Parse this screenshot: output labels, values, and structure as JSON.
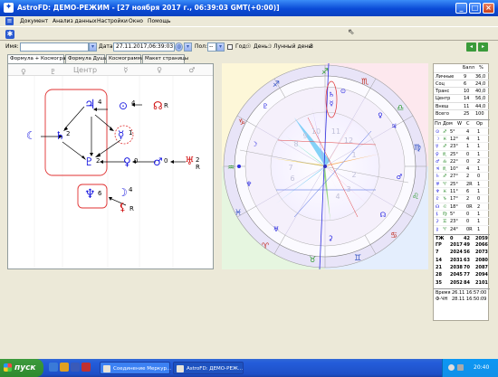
{
  "window": {
    "title": "AstroFD: ДЕМО-РЕЖИМ - [27 ноября 2017 г., 06:39:03 GMT(+0:00)]",
    "minimize": "_",
    "maximize": "□",
    "close": "×"
  },
  "menu": [
    "Документ",
    "Анализ данных",
    "Настройки",
    "Окно",
    "Помощь"
  ],
  "toolbar": {
    "name_label": "Имя:",
    "name_value": "",
    "date_label": "Дата:",
    "date_value": "27.11.2017,06:39:03",
    "pol_label": "Пол:",
    "pol_value": "--",
    "year_label": "Год:",
    "day_label": "День:",
    "lunar_label": "Лунный день:",
    "lunar_value": "8"
  },
  "tabs": [
    "Формула + Космограмма",
    "Формула Души",
    "Космограмма",
    "Макет страницы"
  ],
  "formula": {
    "col_header": "Центр",
    "col_symbols": [
      "☿",
      "♀",
      "♂"
    ],
    "glyphs": [
      {
        "sym": "☾",
        "color": "#1a1ae0"
      },
      {
        "sym": "♄",
        "color": "#1a1ae0",
        "n": "2"
      },
      {
        "sym": "♃",
        "color": "#1a1ae0",
        "n": "4"
      },
      {
        "sym": "⊙",
        "color": "#1a1ae0",
        "n": "4"
      },
      {
        "sym": "☊",
        "color": "#d01010",
        "n": "R"
      },
      {
        "sym": "☿",
        "color": "#1a1ae0",
        "n": "1"
      },
      {
        "sym": "♇",
        "color": "#1a1ae0",
        "n": "2"
      },
      {
        "sym": "♀",
        "color": "#1a1ae0",
        "n": "0"
      },
      {
        "sym": "♂",
        "color": "#1a1ae0",
        "n": "0"
      },
      {
        "sym": "♅",
        "color": "#d01010",
        "n": "2"
      },
      {
        "sym": "♆",
        "color": "#1a1ae0",
        "n": "6"
      },
      {
        "sym": "☽",
        "color": "#1a1ae0",
        "n": "4"
      },
      {
        "sym": "⚸",
        "color": "#d01010",
        "n": "R"
      },
      {
        "sym": "♀",
        "color": "#1a1ae0"
      },
      {
        "sym": "♇",
        "color": "#1a1ae0"
      },
      {
        "sym": "R",
        "color": "#d01010"
      },
      {
        "sym": "R",
        "color": "#d01010"
      }
    ]
  },
  "stats": {
    "head_ball": "Балл",
    "head_pct": "%",
    "rows": [
      {
        "label": "Личные",
        "ball": "9",
        "pct": "36,0"
      },
      {
        "label": "Соц",
        "ball": "6",
        "pct": "24,0"
      },
      {
        "label": "Транс",
        "ball": "10",
        "pct": "40,0"
      },
      {
        "label": "Центр",
        "ball": "14",
        "pct": "56,0"
      },
      {
        "label": "Внеш",
        "ball": "11",
        "pct": "44,0"
      },
      {
        "label": "Всего",
        "ball": "25",
        "pct": "100"
      }
    ],
    "planet_head": [
      "Пл",
      "Дом",
      "W",
      "С",
      "Ор"
    ],
    "planets": [
      {
        "p": "⊙",
        "d": "♐",
        "deg": "5°",
        "w": "4",
        "s": "1"
      },
      {
        "p": "☽",
        "d": "♓",
        "deg": "12°",
        "w": "4",
        "s": "1"
      },
      {
        "p": "☿",
        "d": "♐",
        "deg": "23°",
        "w": "1",
        "s": "1"
      },
      {
        "p": "♀",
        "d": "♏",
        "deg": "25°",
        "w": "0",
        "s": "1"
      },
      {
        "p": "♂",
        "d": "♎",
        "deg": "22°",
        "w": "0",
        "s": "2"
      },
      {
        "p": "♃",
        "d": "♏",
        "deg": "10°",
        "w": "4",
        "s": "1"
      },
      {
        "p": "♄",
        "d": "♐",
        "deg": "27°",
        "w": "2",
        "s": "0"
      },
      {
        "p": "♅",
        "d": "♈",
        "deg": "25°",
        "w": "2R",
        "s": "1"
      },
      {
        "p": "♆",
        "d": "♓",
        "deg": "11°",
        "w": "6",
        "s": "1"
      },
      {
        "p": "♇",
        "d": "♑",
        "deg": "17°",
        "w": "2",
        "s": "0"
      },
      {
        "p": "☊",
        "d": "♌",
        "deg": "18°",
        "w": "0R",
        "s": "2"
      },
      {
        "p": "⚸",
        "d": "♍",
        "deg": "5°",
        "w": "0",
        "s": "1"
      },
      {
        "p": "⚳",
        "d": "♊",
        "deg": "23°",
        "w": "0",
        "s": "1"
      },
      {
        "p": "⚷",
        "d": "♈",
        "deg": "24°",
        "w": "0R",
        "s": "1"
      }
    ],
    "years_head": [
      "ТЖ",
      "0",
      "42",
      "2059"
    ],
    "years": [
      [
        "ГР",
        "2017",
        "49",
        "2066"
      ],
      [
        "7",
        "2024",
        "56",
        "2073"
      ],
      [
        "14",
        "2031",
        "63",
        "2080"
      ],
      [
        "21",
        "2038",
        "70",
        "2087"
      ],
      [
        "28",
        "2045",
        "77",
        "2094"
      ],
      [
        "35",
        "2052",
        "84",
        "2101"
      ]
    ],
    "time_label": "Время",
    "time_value": "26.11 16:57:00",
    "fchs_label": "Ф-ЧН",
    "fchs_value": "28.11 16:50:09"
  },
  "chart_numbers": [
    "7",
    "8",
    "9",
    "10",
    "11",
    "12",
    "1",
    "2",
    "3",
    "4",
    "5",
    "6"
  ],
  "taskbar": {
    "start": "пуск",
    "tasks": [
      "Соединение Меркур...",
      "AstroFD: ДЕМО-РЕЖ..."
    ],
    "clock": "20:40"
  }
}
